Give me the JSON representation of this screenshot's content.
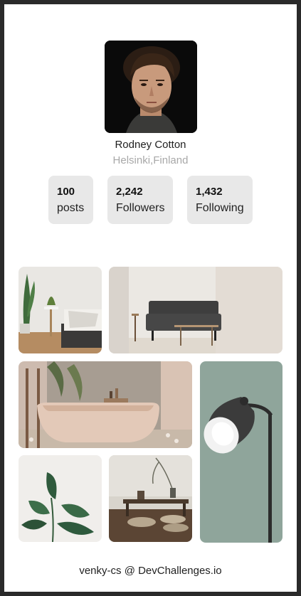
{
  "profile": {
    "name": "Rodney Cotton",
    "location": "Helsinki,Finland"
  },
  "stats": [
    {
      "value": "100",
      "label": "posts"
    },
    {
      "value": "2,242",
      "label": "Followers"
    },
    {
      "value": "1,432",
      "label": "Following"
    }
  ],
  "footer": {
    "text": "venky-cs @ DevChallenges.io"
  },
  "gallery": [
    {
      "name": "living-room-plant-photo"
    },
    {
      "name": "gray-sofa-photo"
    },
    {
      "name": "bathtub-photo"
    },
    {
      "name": "desk-lamp-photo"
    },
    {
      "name": "plant-leaves-photo"
    },
    {
      "name": "low-table-photo"
    }
  ],
  "colors": {
    "stat_background": "#e8e8e8",
    "location_text": "#a8a8a8",
    "lamp_wall": "#8fa59b"
  }
}
